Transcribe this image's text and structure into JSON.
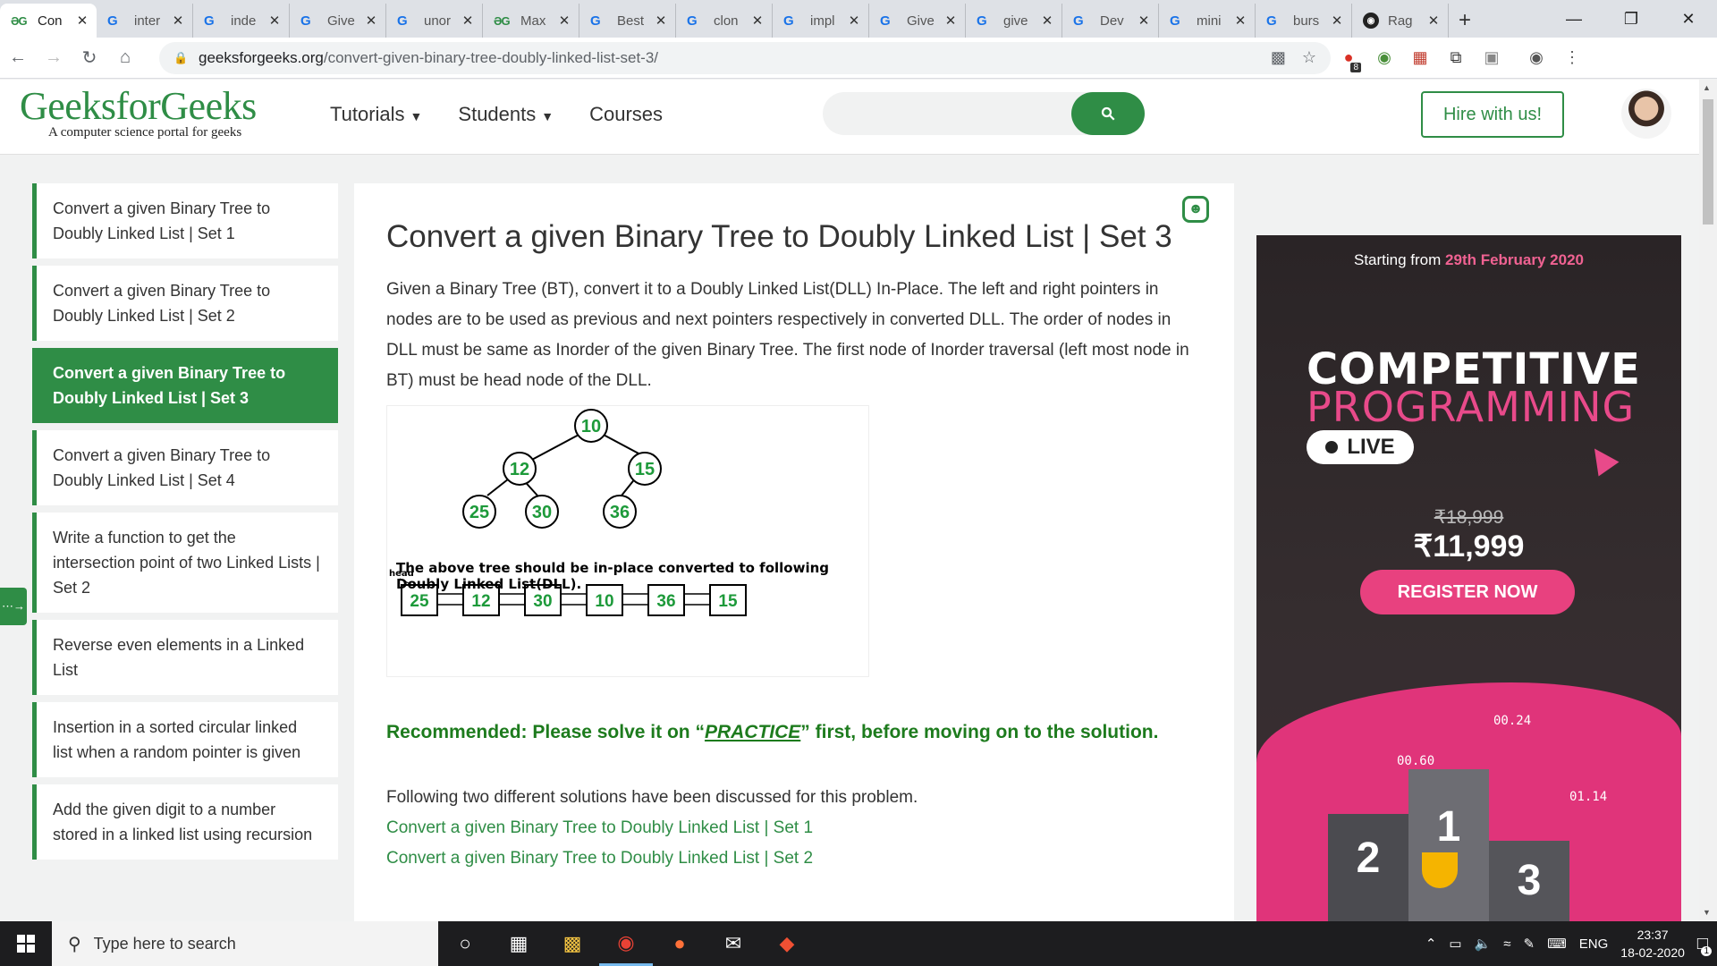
{
  "browser": {
    "tabs": [
      {
        "icon": "gfg",
        "title": "Con",
        "active": true
      },
      {
        "icon": "google",
        "title": "inter"
      },
      {
        "icon": "google",
        "title": "inde"
      },
      {
        "icon": "google",
        "title": "Give"
      },
      {
        "icon": "google",
        "title": "unor"
      },
      {
        "icon": "gfg",
        "title": "Max"
      },
      {
        "icon": "google",
        "title": "Best"
      },
      {
        "icon": "google",
        "title": "clon"
      },
      {
        "icon": "google",
        "title": "impl"
      },
      {
        "icon": "google",
        "title": "Give"
      },
      {
        "icon": "google",
        "title": "give"
      },
      {
        "icon": "google",
        "title": "Dev"
      },
      {
        "icon": "google",
        "title": "mini"
      },
      {
        "icon": "google",
        "title": "burs"
      },
      {
        "icon": "github",
        "title": "Rag"
      }
    ],
    "url_host": "geeksforgeeks.org",
    "url_path": "/convert-given-binary-tree-doubly-linked-list-set-3/",
    "extension_badge": "8"
  },
  "site": {
    "brand": "GeeksforGeeks",
    "tagline": "A computer science portal for geeks",
    "nav": [
      {
        "label": "Tutorials",
        "dropdown": true
      },
      {
        "label": "Students",
        "dropdown": true
      },
      {
        "label": "Courses",
        "dropdown": false
      }
    ],
    "search_placeholder": "",
    "hire_button": "Hire with us!",
    "accent_color": "#2f8d46"
  },
  "sidebar": {
    "items": [
      {
        "label": "Convert a given Binary Tree to Doubly Linked List | Set 1"
      },
      {
        "label": "Convert a given Binary Tree to Doubly Linked List | Set 2"
      },
      {
        "label": "Convert a given Binary Tree to Doubly Linked List | Set 3",
        "active": true
      },
      {
        "label": "Convert a given Binary Tree to Doubly Linked List | Set 4"
      },
      {
        "label": "Write a function to get the intersection point of two Linked Lists | Set 2"
      },
      {
        "label": "Reverse even elements in a Linked List"
      },
      {
        "label": "Insertion in a sorted circular linked list when a random pointer is given"
      },
      {
        "label": "Add the given digit to a number stored in a linked list using recursion"
      }
    ]
  },
  "article": {
    "title": "Convert a given Binary Tree to Doubly Linked List | Set 3",
    "intro": "Given a Binary Tree (BT), convert it to a Doubly Linked List(DLL) In-Place. The left and right pointers in nodes are to be used as previous and next pointers respectively in converted DLL. The order of nodes in DLL must be same as Inorder of the given Binary Tree. The first node of Inorder traversal (left most node in BT) must be head node of the DLL.",
    "figure": {
      "tree_nodes": [
        "10",
        "12",
        "15",
        "25",
        "30",
        "36"
      ],
      "caption": "The above tree should be in-place converted to following Doubly Linked List(DLL).",
      "head_label": "head",
      "dll_nodes": [
        "25",
        "12",
        "30",
        "10",
        "36",
        "15"
      ]
    },
    "recommended_prefix": "Recommended: Please solve it on “",
    "recommended_link": "PRACTICE",
    "recommended_suffix": "” first, before moving on to the solution.",
    "following_text": "Following two different solutions have been discussed for this problem.",
    "links": [
      "Convert a given Binary Tree to Doubly Linked List | Set 1",
      "Convert a given Binary Tree to Doubly Linked List | Set 2"
    ]
  },
  "ad": {
    "starting_prefix": "Starting from ",
    "starting_date": "29th February 2020",
    "line1": "COMPETITIVE",
    "line2": "PROGRAMMING",
    "live": "LIVE",
    "old_price": "₹18,999",
    "new_price": "₹11,999",
    "register": "REGISTER NOW",
    "timers": [
      "00.24",
      "00.60",
      "01.14"
    ],
    "podium": [
      "2",
      "1",
      "3"
    ]
  },
  "taskbar": {
    "search_placeholder": "Type here to search",
    "language": "ENG",
    "time": "23:37",
    "date": "18-02-2020",
    "notification_count": "1"
  }
}
